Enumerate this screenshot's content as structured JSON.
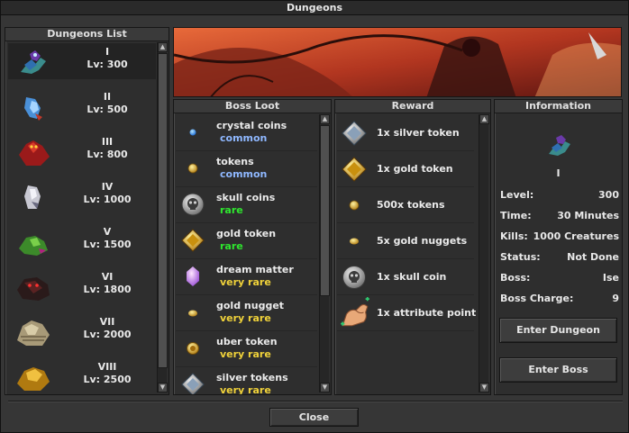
{
  "window": {
    "title": "Dungeons"
  },
  "dungeons_list": {
    "header": "Dungeons List",
    "items": [
      {
        "name": "I",
        "level": "Lv: 300",
        "icon": "demon-rider-icon",
        "selected": true
      },
      {
        "name": "II",
        "level": "Lv: 500",
        "icon": "blue-creature-icon"
      },
      {
        "name": "III",
        "level": "Lv: 800",
        "icon": "red-demon-icon"
      },
      {
        "name": "IV",
        "level": "Lv: 1000",
        "icon": "white-creature-icon"
      },
      {
        "name": "V",
        "level": "Lv: 1500",
        "icon": "green-beast-icon"
      },
      {
        "name": "VI",
        "level": "Lv: 1800",
        "icon": "dark-beast-icon"
      },
      {
        "name": "VII",
        "level": "Lv: 2000",
        "icon": "bone-dragon-icon"
      },
      {
        "name": "VIII",
        "level": "Lv: 2500",
        "icon": "golden-dragon-icon"
      }
    ]
  },
  "boss_loot": {
    "header": "Boss Loot",
    "items": [
      {
        "name": "crystal coins",
        "rarity": "common",
        "rarity_color": "#8fb8ff",
        "icon": "crystal-coin-icon"
      },
      {
        "name": "tokens",
        "rarity": "common",
        "rarity_color": "#8fb8ff",
        "icon": "token-icon"
      },
      {
        "name": "skull coins",
        "rarity": "rare",
        "rarity_color": "#2ee62e",
        "icon": "skull-coin-icon"
      },
      {
        "name": "gold token",
        "rarity": "rare",
        "rarity_color": "#2ee62e",
        "icon": "gold-token-icon"
      },
      {
        "name": "dream matter",
        "rarity": "very rare",
        "rarity_color": "#f0d23a",
        "icon": "dream-matter-icon"
      },
      {
        "name": "gold nugget",
        "rarity": "very rare",
        "rarity_color": "#f0d23a",
        "icon": "gold-nugget-icon"
      },
      {
        "name": "uber token",
        "rarity": "very rare",
        "rarity_color": "#f0d23a",
        "icon": "uber-token-icon"
      },
      {
        "name": "silver tokens",
        "rarity": "very rare",
        "rarity_color": "#f0d23a",
        "icon": "silver-token-icon"
      }
    ]
  },
  "reward": {
    "header": "Reward",
    "items": [
      {
        "text": "1x silver token",
        "icon": "silver-token-icon"
      },
      {
        "text": "1x gold token",
        "icon": "gold-token-icon"
      },
      {
        "text": "500x tokens",
        "icon": "token-icon"
      },
      {
        "text": "5x gold nuggets",
        "icon": "gold-nugget-icon"
      },
      {
        "text": "1x skull coin",
        "icon": "skull-coin-icon"
      },
      {
        "text": "1x attribute point",
        "icon": "flexed-arm-icon"
      }
    ]
  },
  "information": {
    "header": "Information",
    "dungeon_name": "I",
    "rows": [
      {
        "key": "Level:",
        "value": "300"
      },
      {
        "key": "Time:",
        "value": "30 Minutes"
      },
      {
        "key": "Kills:",
        "value": "1000 Creatures"
      },
      {
        "key": "Status:",
        "value": "Not Done"
      },
      {
        "key": "Boss:",
        "value": "Ise"
      },
      {
        "key": "Boss Charge:",
        "value": "9"
      }
    ],
    "enter_dungeon_label": "Enter Dungeon",
    "enter_boss_label": "Enter Boss"
  },
  "footer": {
    "close_label": "Close"
  },
  "colors": {
    "window_bg": "#363636",
    "panel_bg": "#2e2e2e",
    "common": "#8fb8ff",
    "rare": "#2ee62e",
    "very_rare": "#f0d23a"
  }
}
